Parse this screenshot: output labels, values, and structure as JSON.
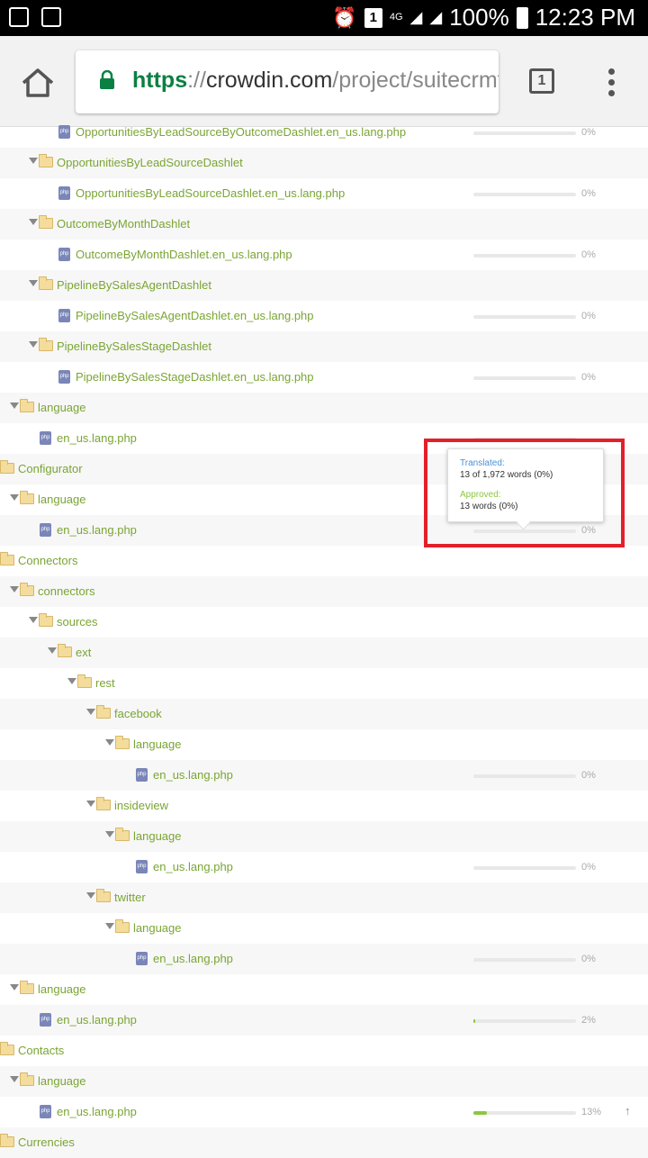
{
  "status_bar": {
    "network": "4G",
    "battery": "100%",
    "time": "12:23 PM",
    "notification_count": "1"
  },
  "browser": {
    "url_scheme": "https",
    "url_sep": "://",
    "url_host": "crowdin.com",
    "url_path": "/project/suitecrmtr",
    "tab_count": "1"
  },
  "tree": {
    "rows": [
      {
        "kind": "file",
        "indent": 84,
        "label": "OpportunitiesByLeadSourceByOutcomeDashlet.en_us.lang.php",
        "pct": "0%",
        "progress": 0
      },
      {
        "kind": "folder",
        "indent": 63,
        "label": "OpportunitiesByLeadSourceDashlet",
        "expanded": true
      },
      {
        "kind": "file",
        "indent": 84,
        "label": "OpportunitiesByLeadSourceDashlet.en_us.lang.php",
        "pct": "0%",
        "progress": 0
      },
      {
        "kind": "folder",
        "indent": 63,
        "label": "OutcomeByMonthDashlet",
        "expanded": true
      },
      {
        "kind": "file",
        "indent": 84,
        "label": "OutcomeByMonthDashlet.en_us.lang.php",
        "pct": "0%",
        "progress": 0
      },
      {
        "kind": "folder",
        "indent": 63,
        "label": "PipelineBySalesAgentDashlet",
        "expanded": true
      },
      {
        "kind": "file",
        "indent": 84,
        "label": "PipelineBySalesAgentDashlet.en_us.lang.php",
        "pct": "0%",
        "progress": 0
      },
      {
        "kind": "folder",
        "indent": 63,
        "label": "PipelineBySalesStageDashlet",
        "expanded": true
      },
      {
        "kind": "file",
        "indent": 84,
        "label": "PipelineBySalesStageDashlet.en_us.lang.php",
        "pct": "0%",
        "progress": 0
      },
      {
        "kind": "folder",
        "indent": 42,
        "label": "language",
        "expanded": true
      },
      {
        "kind": "file",
        "indent": 63,
        "label": "en_us.lang.php",
        "pct": "",
        "progress": 0
      },
      {
        "kind": "folder",
        "indent": 20,
        "label": "Configurator",
        "expanded": false
      },
      {
        "kind": "folder",
        "indent": 42,
        "label": "language",
        "expanded": true
      },
      {
        "kind": "file",
        "indent": 63,
        "label": "en_us.lang.php",
        "pct": "0%",
        "progress": 0
      },
      {
        "kind": "folder",
        "indent": 20,
        "label": "Connectors",
        "expanded": false
      },
      {
        "kind": "folder",
        "indent": 42,
        "label": "connectors",
        "expanded": true
      },
      {
        "kind": "folder",
        "indent": 63,
        "label": "sources",
        "expanded": true
      },
      {
        "kind": "folder",
        "indent": 84,
        "label": "ext",
        "expanded": true
      },
      {
        "kind": "folder",
        "indent": 106,
        "label": "rest",
        "expanded": true
      },
      {
        "kind": "folder",
        "indent": 127,
        "label": "facebook",
        "expanded": true
      },
      {
        "kind": "folder",
        "indent": 148,
        "label": "language",
        "expanded": true
      },
      {
        "kind": "file",
        "indent": 170,
        "label": "en_us.lang.php",
        "pct": "0%",
        "progress": 0
      },
      {
        "kind": "folder",
        "indent": 127,
        "label": "insideview",
        "expanded": true
      },
      {
        "kind": "folder",
        "indent": 148,
        "label": "language",
        "expanded": true
      },
      {
        "kind": "file",
        "indent": 170,
        "label": "en_us.lang.php",
        "pct": "0%",
        "progress": 0
      },
      {
        "kind": "folder",
        "indent": 127,
        "label": "twitter",
        "expanded": true
      },
      {
        "kind": "folder",
        "indent": 148,
        "label": "language",
        "expanded": true
      },
      {
        "kind": "file",
        "indent": 170,
        "label": "en_us.lang.php",
        "pct": "0%",
        "progress": 0
      },
      {
        "kind": "folder",
        "indent": 42,
        "label": "language",
        "expanded": true
      },
      {
        "kind": "file",
        "indent": 63,
        "label": "en_us.lang.php",
        "pct": "2%",
        "progress": 0.02
      },
      {
        "kind": "folder",
        "indent": 20,
        "label": "Contacts",
        "expanded": false
      },
      {
        "kind": "folder",
        "indent": 42,
        "label": "language",
        "expanded": true
      },
      {
        "kind": "file",
        "indent": 63,
        "label": "en_us.lang.php",
        "pct": "13%",
        "progress": 0.13,
        "upload": true
      },
      {
        "kind": "folder",
        "indent": 20,
        "label": "Currencies",
        "expanded": false
      }
    ]
  },
  "tooltip": {
    "translated_label": "Translated:",
    "translated_value": "13 of 1,972 words (0%)",
    "approved_label": "Approved:",
    "approved_value": "13 words (0%)",
    "translated_color": "#4a90d9",
    "approved_color": "#8dc63f"
  },
  "colors": {
    "link_green": "#7aa534",
    "highlight_red": "#e3202a",
    "progress_green": "#8dc63f"
  }
}
